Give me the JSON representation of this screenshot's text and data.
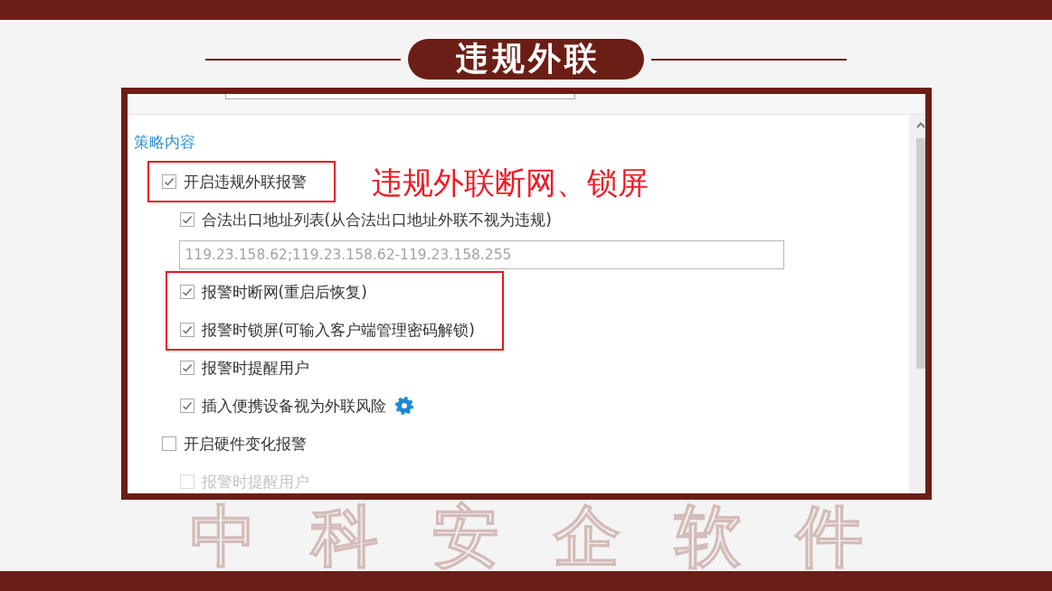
{
  "slide": {
    "title": "违规外联",
    "footer_text": "中科安企软件"
  },
  "policy_panel": {
    "section_title": "策略内容",
    "annotation": "违规外联断网、锁屏",
    "options": [
      {
        "kind": "checkbox",
        "label": "开启违规外联报警",
        "checked": true,
        "disabled": false,
        "highlighted": true,
        "settings_icon": false,
        "children": [
          {
            "kind": "checkbox",
            "label": "合法出口地址列表(从合法出口地址外联不视为违规)",
            "checked": true,
            "disabled": false,
            "highlighted": false,
            "settings_icon": false
          },
          {
            "kind": "field",
            "value": "119.23.158.62;119.23.158.62-119.23.158.255"
          },
          {
            "kind": "checkbox",
            "label": "报警时断网(重启后恢复)",
            "checked": true,
            "disabled": false,
            "highlighted": true,
            "settings_icon": false
          },
          {
            "kind": "checkbox",
            "label": "报警时锁屏(可输入客户端管理密码解锁)",
            "checked": true,
            "disabled": false,
            "highlighted": true,
            "settings_icon": false
          },
          {
            "kind": "checkbox",
            "label": "报警时提醒用户",
            "checked": true,
            "disabled": false,
            "highlighted": false,
            "settings_icon": false
          },
          {
            "kind": "checkbox",
            "label": "插入便携设备视为外联风险",
            "checked": true,
            "disabled": false,
            "highlighted": false,
            "settings_icon": true
          }
        ]
      },
      {
        "kind": "checkbox",
        "label": "开启硬件变化报警",
        "checked": false,
        "disabled": false,
        "highlighted": false,
        "settings_icon": false,
        "children": [
          {
            "kind": "checkbox",
            "label": "报警时提醒用户",
            "checked": false,
            "disabled": true,
            "highlighted": false,
            "settings_icon": false
          }
        ]
      }
    ]
  }
}
